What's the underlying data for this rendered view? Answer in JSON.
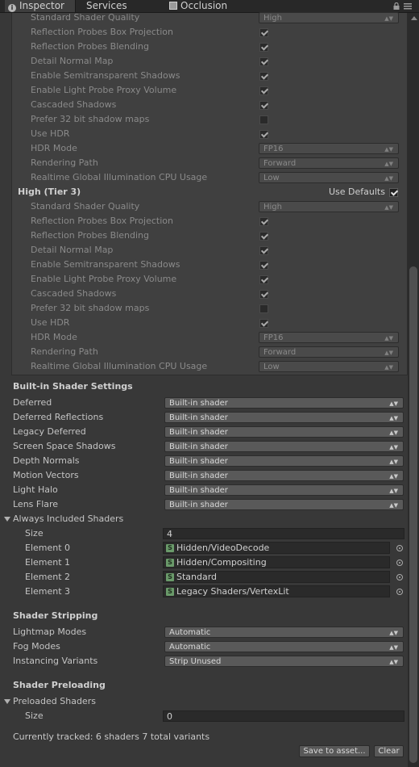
{
  "tabs": [
    {
      "label": "Inspector",
      "icon": "info-icon",
      "active": true
    },
    {
      "label": "Services",
      "active": false
    },
    {
      "label": "Occlusion",
      "icon": "occlusion-icon",
      "active": false
    }
  ],
  "tier_settings_labels": {
    "standard_shader_quality": "Standard Shader Quality",
    "reflection_box_projection": "Reflection Probes Box Projection",
    "reflection_blending": "Reflection Probes Blending",
    "detail_normal_map": "Detail Normal Map",
    "semitransparent_shadows": "Enable Semitransparent Shadows",
    "light_probe_proxy": "Enable Light Probe Proxy Volume",
    "cascaded_shadows": "Cascaded Shadows",
    "prefer_32bit_shadow": "Prefer 32 bit shadow maps",
    "use_hdr": "Use HDR",
    "hdr_mode": "HDR Mode",
    "rendering_path": "Rendering Path",
    "realtime_gi_cpu": "Realtime Global Illumination CPU Usage"
  },
  "tier2": {
    "standard_shader_quality": "High",
    "reflection_box_projection": true,
    "reflection_blending": true,
    "detail_normal_map": true,
    "semitransparent_shadows": true,
    "light_probe_proxy": true,
    "cascaded_shadows": true,
    "prefer_32bit_shadow": false,
    "use_hdr": true,
    "hdr_mode": "FP16",
    "rendering_path": "Forward",
    "realtime_gi_cpu": "Low"
  },
  "tier3": {
    "title": "High (Tier 3)",
    "use_defaults_label": "Use Defaults",
    "use_defaults": true,
    "standard_shader_quality": "High",
    "reflection_box_projection": true,
    "reflection_blending": true,
    "detail_normal_map": true,
    "semitransparent_shadows": true,
    "light_probe_proxy": true,
    "cascaded_shadows": true,
    "prefer_32bit_shadow": false,
    "use_hdr": true,
    "hdr_mode": "FP16",
    "rendering_path": "Forward",
    "realtime_gi_cpu": "Low"
  },
  "builtin": {
    "title": "Built-in Shader Settings",
    "rows": [
      {
        "label": "Deferred",
        "value": "Built-in shader"
      },
      {
        "label": "Deferred Reflections",
        "value": "Built-in shader"
      },
      {
        "label": "Legacy Deferred",
        "value": "Built-in shader"
      },
      {
        "label": "Screen Space Shadows",
        "value": "Built-in shader"
      },
      {
        "label": "Depth Normals",
        "value": "Built-in shader"
      },
      {
        "label": "Motion Vectors",
        "value": "Built-in shader"
      },
      {
        "label": "Light Halo",
        "value": "Built-in shader"
      },
      {
        "label": "Lens Flare",
        "value": "Built-in shader"
      }
    ]
  },
  "always_included": {
    "label": "Always Included Shaders",
    "size_label": "Size",
    "size": "4",
    "elements": [
      {
        "label": "Element 0",
        "value": "Hidden/VideoDecode"
      },
      {
        "label": "Element 1",
        "value": "Hidden/Compositing"
      },
      {
        "label": "Element 2",
        "value": "Standard"
      },
      {
        "label": "Element 3",
        "value": "Legacy Shaders/VertexLit"
      }
    ]
  },
  "stripping": {
    "title": "Shader Stripping",
    "rows": [
      {
        "label": "Lightmap Modes",
        "value": "Automatic"
      },
      {
        "label": "Fog Modes",
        "value": "Automatic"
      },
      {
        "label": "Instancing Variants",
        "value": "Strip Unused"
      }
    ]
  },
  "preloading": {
    "title": "Shader Preloading",
    "preloaded_label": "Preloaded Shaders",
    "size_label": "Size",
    "size": "0",
    "tracked": "Currently tracked: 6 shaders 7 total variants",
    "save_label": "Save to asset...",
    "clear_label": "Clear"
  },
  "shader_icon_glyph": "S"
}
